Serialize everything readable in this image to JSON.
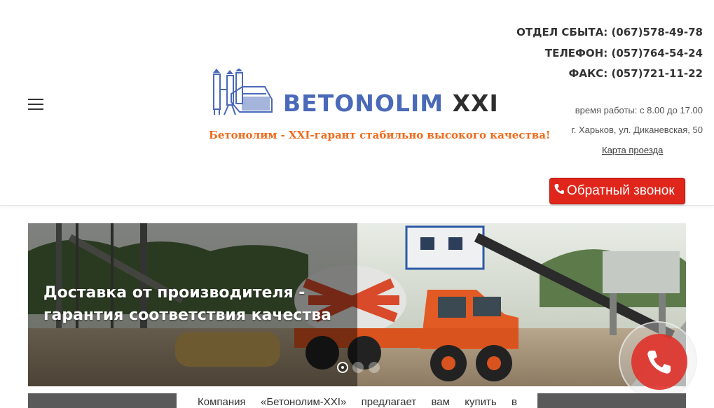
{
  "header": {
    "menu_icon": "hamburger-menu-icon",
    "logo": {
      "brand": "BETONOLIM",
      "suffix": "XXI"
    },
    "slogan": "Бетонолим - XXI-гарант стабильно высокого качества!",
    "contacts": {
      "sales": "ОТДЕЛ СБЫТА: (067)578-49-78",
      "phone": "ТЕЛЕФОН: (057)764-54-24",
      "fax": "ФАКС: (057)721-11-22"
    },
    "hours": "время работы: с 8.00 до 17.00",
    "address": "г. Харьков, ул. Диканевская, 50",
    "map_link": "Карта проезда",
    "callback_button": "Обратный звонок"
  },
  "slider": {
    "caption_line1": "Доставка от производителя -",
    "caption_line2": "гарантия соответствия качества",
    "active_slide": 1,
    "slide_count": 3
  },
  "content": {
    "intro": "Компания «Бетонолим-XXI» предлагает вам купить в"
  },
  "colors": {
    "brand_blue": "#4a69b8",
    "slogan_orange": "#f06b1c",
    "callback_red": "#e0261b"
  }
}
